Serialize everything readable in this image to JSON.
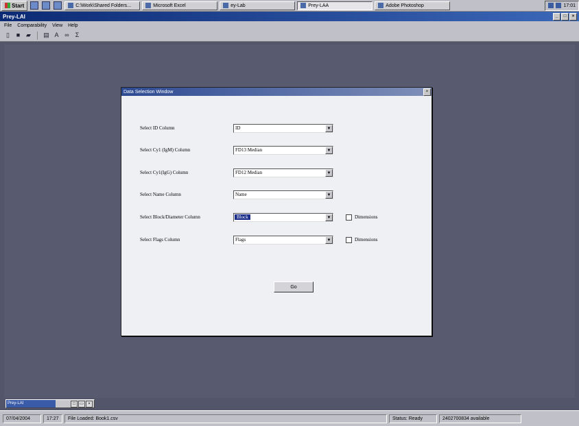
{
  "taskbar": {
    "start_label": "Start",
    "tasks": [
      "C:\\Work\\Shared Folders...",
      "Microsoft Excel",
      "ey-Lab",
      "Prey-LAA",
      "Adobe Photoshop"
    ],
    "clock": "17:01"
  },
  "app": {
    "title": "Prey-LAI",
    "menus": [
      "File",
      "Comparability",
      "View",
      "Help"
    ]
  },
  "dialog": {
    "title": "Data Selection Window",
    "rows": [
      {
        "label": "Select ID Column",
        "value": "ID"
      },
      {
        "label": "Select Cy1 (IgM) Column",
        "value": "FD13 Median"
      },
      {
        "label": "Select Cy1(IgG) Column",
        "value": "FD12 Median"
      },
      {
        "label": "Select Name Column",
        "value": "Name"
      },
      {
        "label": "Select Block/Diameter Column",
        "value": "Block",
        "selected": true,
        "checkbox": "Dimensions"
      },
      {
        "label": "Select Flags Column",
        "value": "Flags"
      }
    ],
    "second_checkbox": "Dimensions",
    "go_label": "Go"
  },
  "minimized": {
    "title": "Prey-LAI"
  },
  "status": {
    "date": "07/04/2004",
    "time": "17:27",
    "message": "File Loaded: Book1.csv",
    "state": "Status: Ready",
    "memory": "2402700834 available"
  }
}
